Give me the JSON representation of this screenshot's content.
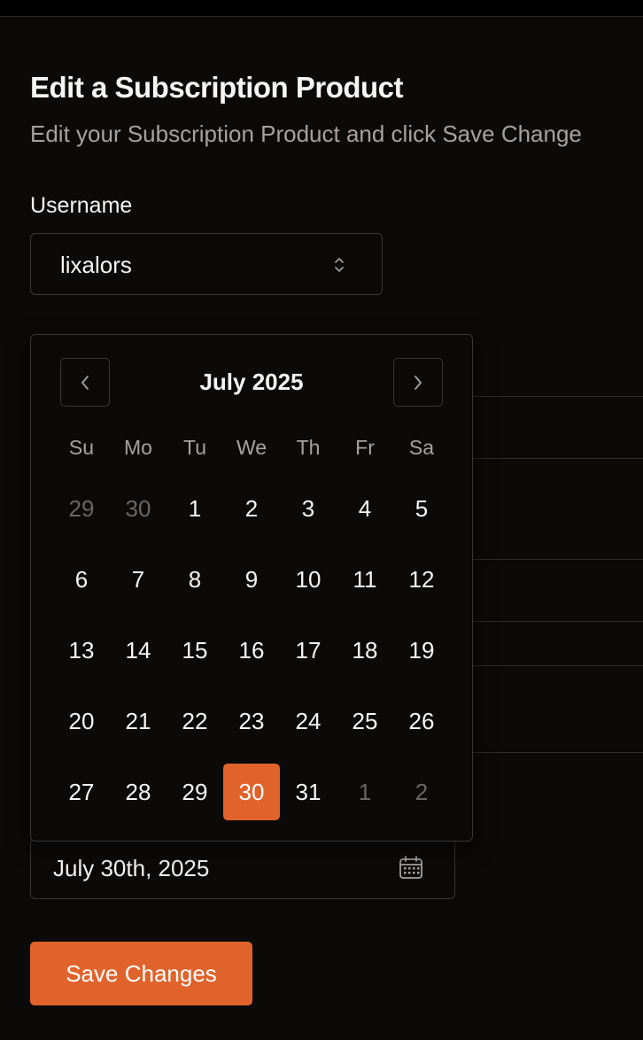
{
  "header": {
    "title": "Edit a Subscription Product",
    "subtitle": "Edit your Subscription Product and click Save Change"
  },
  "username": {
    "label": "Username",
    "value": "lixalors"
  },
  "calendar": {
    "month_label": "July 2025",
    "weekdays": [
      "Su",
      "Mo",
      "Tu",
      "We",
      "Th",
      "Fr",
      "Sa"
    ],
    "weeks": [
      [
        {
          "d": "29",
          "out": true
        },
        {
          "d": "30",
          "out": true
        },
        {
          "d": "1"
        },
        {
          "d": "2"
        },
        {
          "d": "3"
        },
        {
          "d": "4"
        },
        {
          "d": "5"
        }
      ],
      [
        {
          "d": "6"
        },
        {
          "d": "7"
        },
        {
          "d": "8"
        },
        {
          "d": "9"
        },
        {
          "d": "10"
        },
        {
          "d": "11"
        },
        {
          "d": "12"
        }
      ],
      [
        {
          "d": "13"
        },
        {
          "d": "14"
        },
        {
          "d": "15"
        },
        {
          "d": "16"
        },
        {
          "d": "17"
        },
        {
          "d": "18"
        },
        {
          "d": "19"
        }
      ],
      [
        {
          "d": "20"
        },
        {
          "d": "21"
        },
        {
          "d": "22"
        },
        {
          "d": "23"
        },
        {
          "d": "24"
        },
        {
          "d": "25"
        },
        {
          "d": "26"
        }
      ],
      [
        {
          "d": "27"
        },
        {
          "d": "28"
        },
        {
          "d": "29"
        },
        {
          "d": "30",
          "selected": true
        },
        {
          "d": "31"
        },
        {
          "d": "1",
          "out": true
        },
        {
          "d": "2",
          "out": true
        }
      ]
    ],
    "prev_icon": "chevron-left-icon",
    "next_icon": "chevron-right-icon"
  },
  "date_field": {
    "value": "July 30th, 2025",
    "icon": "calendar-icon"
  },
  "actions": {
    "save_label": "Save Changes"
  },
  "colors": {
    "accent": "#e0632b",
    "background": "#0b0a09",
    "border": "#3a3735",
    "muted_text": "#a8a29e"
  }
}
